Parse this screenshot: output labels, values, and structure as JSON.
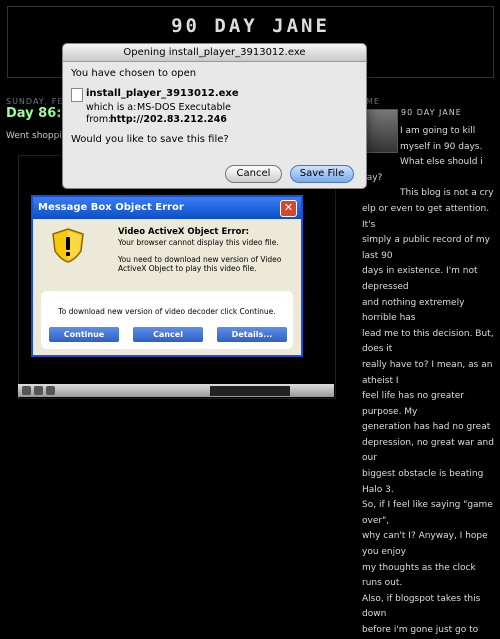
{
  "blog": {
    "title": "90 DAY JANE",
    "date_header": "SUNDAY, FEB",
    "post_title": "Day 86: D",
    "post_body": "Went shopping",
    "sidebar_header": "ME",
    "profile_name": "90 DAY JANE",
    "sidebar_lines": [
      "I am going to kill",
      "myself in 90 days.",
      "What else should i say?",
      "This blog is not a cry",
      "elp or even to get attention. It's",
      "simply a public record of my last 90",
      "days in existence. I'm not depressed",
      "and nothing extremely horrible has",
      "lead me to this decision. But, does it",
      "really have to? I mean, as an atheist I",
      "feel life has no greater purpose. My",
      "generation has had no great",
      "depression, no great war and our",
      "biggest obstacle is beating Halo 3.",
      "So, if I feel like saying \"game over\",",
      "why can't I? Anyway, I hope you enjoy",
      "my thoughts as the clock runs out.",
      "Also, if blogspot takes this down",
      "before i'm gone just go to"
    ]
  },
  "mac_dialog": {
    "title": "Opening install_player_3913012.exe",
    "heading": "You have chosen to open",
    "file_name": "install_player_3913012.exe",
    "which_label": "which is a:",
    "which_value": "MS-DOS Executable",
    "from_label": "from:",
    "from_value": "http://202.83.212.246",
    "question": "Would you like to save this file?",
    "cancel_label": "Cancel",
    "save_label": "Save File"
  },
  "win_dialog": {
    "title": "Message Box Object Error",
    "close_glyph": "✕",
    "error_title": "Video ActiveX Object Error:",
    "error_sub": "Your browser cannot display this video file.",
    "error_body": "You need to download new version of Video ActiveX Object to play this video file.",
    "download_text": "To download new version of video decoder click Continue.",
    "continue_label": "Continue",
    "cancel_label": "Cancel",
    "details_label": "Details..."
  },
  "colors": {
    "post_title": "#99ff99",
    "win_titlebar": "#0c4ec8",
    "win_button": "#2f5fc4"
  }
}
